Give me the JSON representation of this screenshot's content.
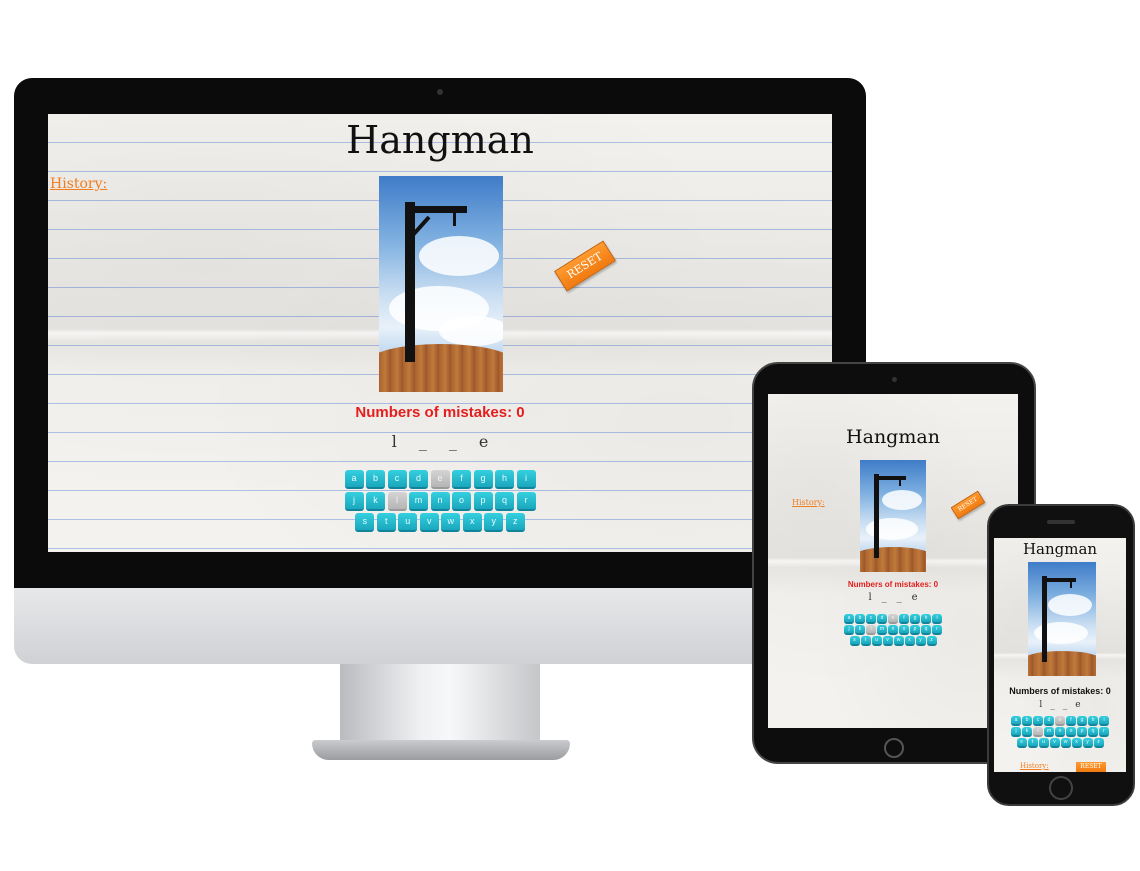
{
  "app": {
    "title": "Hangman",
    "history_label": "History:",
    "mistakes_label": "Numbers of mistakes: 0",
    "reset_label": "RESET",
    "word_slots": [
      "l",
      "_",
      "_",
      "e"
    ],
    "keyboard_rows": [
      [
        "a",
        "b",
        "c",
        "d",
        "e",
        "f",
        "g",
        "h",
        "i"
      ],
      [
        "j",
        "k",
        "l",
        "m",
        "n",
        "o",
        "p",
        "q",
        "r"
      ],
      [
        "s",
        "t",
        "u",
        "v",
        "w",
        "x",
        "y",
        "z"
      ]
    ],
    "used_letters": [
      "e",
      "l"
    ],
    "colors": {
      "mistakes": "#e41e1e",
      "history": "#f07d1e",
      "key": "#22b8cc",
      "key_used": "#c4c4c4",
      "reset": "#f7891c"
    }
  },
  "devices": [
    "desktop",
    "tablet",
    "phone"
  ]
}
